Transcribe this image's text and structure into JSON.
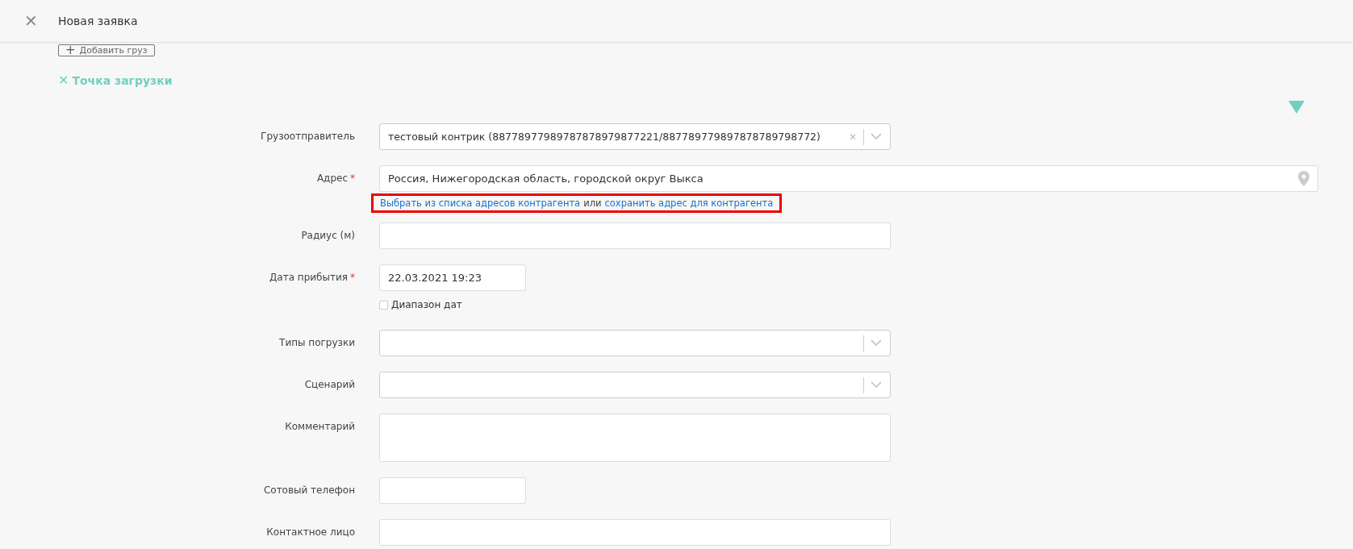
{
  "header": {
    "close": "✕",
    "title": "Новая заявка"
  },
  "add_cargo_button": {
    "icon": "+",
    "label": "Добавить груз"
  },
  "section": {
    "icon": "✕",
    "title": "Точка загрузки"
  },
  "fields": [
    {
      "kind": "select",
      "label": "Грузоотправитель",
      "value": "тестовый контрик (88778977989787878979877221/887789779897878789798772)"
    },
    {
      "kind": "address",
      "label": "Адрес",
      "required_mark": "*",
      "value": "Россия, Нижегородская область, городской округ Выкса",
      "hint": {
        "highlighted": true,
        "parts": [
          {
            "kind": "link",
            "text": "Выбрать из списка адресов контрагента"
          },
          {
            "kind": "text",
            "text": "или"
          },
          {
            "kind": "link",
            "text": "сохранить адрес для контрагента"
          }
        ]
      }
    },
    {
      "kind": "text",
      "label": "Радиус (м)"
    },
    {
      "kind": "date",
      "label": "Дата прибытия",
      "required_mark": "*",
      "value": "22.03.2021 19:23",
      "checkbox": {
        "label": "Диапазон дат",
        "checked": false
      }
    },
    {
      "kind": "select",
      "label": "Типы погрузки"
    },
    {
      "kind": "select",
      "label": "Сценарий"
    },
    {
      "kind": "textarea",
      "label": "Комментарий"
    },
    {
      "kind": "short",
      "label": "Сотовый телефон"
    },
    {
      "kind": "text",
      "label": "Контактное лицо"
    }
  ]
}
